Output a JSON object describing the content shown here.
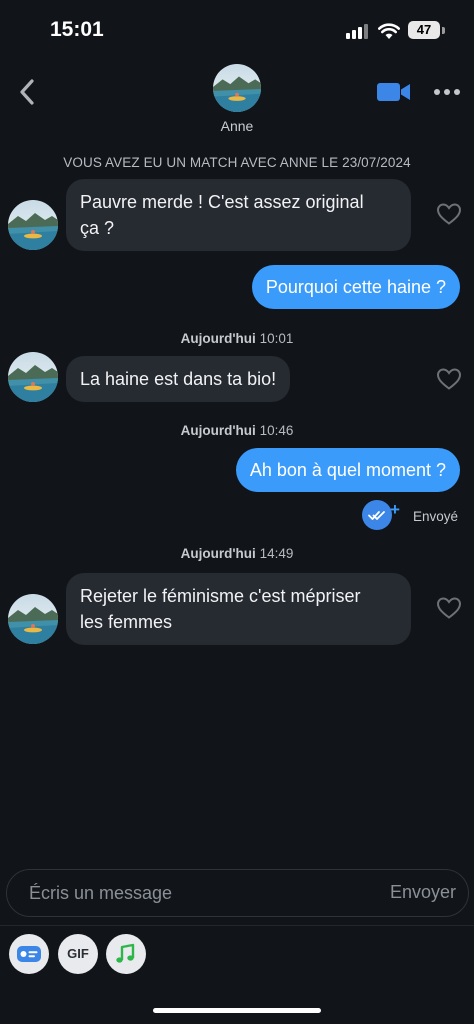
{
  "status_bar": {
    "time": "15:01",
    "battery": "47"
  },
  "header": {
    "name": "Anne"
  },
  "match_notice": "VOUS AVEZ EU UN MATCH AVEC ANNE LE 23/07/2024",
  "messages": [
    {
      "type": "in",
      "lines": [
        "Pauvre merde ! C'est assez original",
        "ça ?"
      ]
    },
    {
      "type": "out",
      "text": "Pourquoi cette haine ?"
    },
    {
      "type": "timestamp",
      "day": "Aujourd'hui",
      "time": "10:01"
    },
    {
      "type": "in",
      "text": "La haine est dans ta bio!"
    },
    {
      "type": "timestamp",
      "day": "Aujourd'hui",
      "time": "10:46"
    },
    {
      "type": "out",
      "text": "Ah bon à quel moment ?"
    },
    {
      "type": "timestamp",
      "day": "Aujourd'hui",
      "time": "14:49"
    },
    {
      "type": "in",
      "lines": [
        "Rejeter le féminisme c'est mépriser",
        "les femmes"
      ]
    }
  ],
  "sent_status": {
    "plus": "+",
    "label": "Envoyé"
  },
  "composer": {
    "placeholder": "Écris un message",
    "send_label": "Envoyer"
  },
  "toolbar": {
    "gif_label": "GIF"
  },
  "icons": [
    "back-chevron-icon",
    "video-call-icon",
    "more-dots-icon",
    "heart-icon",
    "double-check-icon",
    "profile-card-icon",
    "music-note-icon"
  ],
  "colors": {
    "background": "#111418",
    "outgoing_bubble": "#3b9bfb",
    "incoming_bubble": "#262a31",
    "accent": "#3b86e6"
  }
}
